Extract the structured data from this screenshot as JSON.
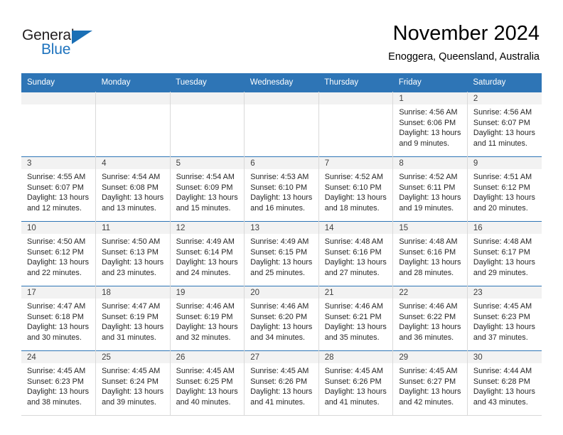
{
  "brand": {
    "name_part1": "General",
    "name_part2": "Blue",
    "logo_icon": "triangle-flag-icon",
    "accent_color": "#1a6fb5"
  },
  "header": {
    "title": "November 2024",
    "subtitle": "Enoggera, Queensland, Australia"
  },
  "calendar": {
    "header_bg": "#2e75b6",
    "daynum_bg": "#f2f2f2",
    "weekday_headers": [
      "Sunday",
      "Monday",
      "Tuesday",
      "Wednesday",
      "Thursday",
      "Friday",
      "Saturday"
    ],
    "weeks": [
      [
        {
          "day": "",
          "empty": true,
          "sunrise": "",
          "sunset": "",
          "daylight_line1": "",
          "daylight_line2": ""
        },
        {
          "day": "",
          "empty": true,
          "sunrise": "",
          "sunset": "",
          "daylight_line1": "",
          "daylight_line2": ""
        },
        {
          "day": "",
          "empty": true,
          "sunrise": "",
          "sunset": "",
          "daylight_line1": "",
          "daylight_line2": ""
        },
        {
          "day": "",
          "empty": true,
          "sunrise": "",
          "sunset": "",
          "daylight_line1": "",
          "daylight_line2": ""
        },
        {
          "day": "",
          "empty": true,
          "sunrise": "",
          "sunset": "",
          "daylight_line1": "",
          "daylight_line2": ""
        },
        {
          "day": "1",
          "empty": false,
          "sunrise": "Sunrise: 4:56 AM",
          "sunset": "Sunset: 6:06 PM",
          "daylight_line1": "Daylight: 13 hours",
          "daylight_line2": "and 9 minutes."
        },
        {
          "day": "2",
          "empty": false,
          "sunrise": "Sunrise: 4:56 AM",
          "sunset": "Sunset: 6:07 PM",
          "daylight_line1": "Daylight: 13 hours",
          "daylight_line2": "and 11 minutes."
        }
      ],
      [
        {
          "day": "3",
          "empty": false,
          "sunrise": "Sunrise: 4:55 AM",
          "sunset": "Sunset: 6:07 PM",
          "daylight_line1": "Daylight: 13 hours",
          "daylight_line2": "and 12 minutes."
        },
        {
          "day": "4",
          "empty": false,
          "sunrise": "Sunrise: 4:54 AM",
          "sunset": "Sunset: 6:08 PM",
          "daylight_line1": "Daylight: 13 hours",
          "daylight_line2": "and 13 minutes."
        },
        {
          "day": "5",
          "empty": false,
          "sunrise": "Sunrise: 4:54 AM",
          "sunset": "Sunset: 6:09 PM",
          "daylight_line1": "Daylight: 13 hours",
          "daylight_line2": "and 15 minutes."
        },
        {
          "day": "6",
          "empty": false,
          "sunrise": "Sunrise: 4:53 AM",
          "sunset": "Sunset: 6:10 PM",
          "daylight_line1": "Daylight: 13 hours",
          "daylight_line2": "and 16 minutes."
        },
        {
          "day": "7",
          "empty": false,
          "sunrise": "Sunrise: 4:52 AM",
          "sunset": "Sunset: 6:10 PM",
          "daylight_line1": "Daylight: 13 hours",
          "daylight_line2": "and 18 minutes."
        },
        {
          "day": "8",
          "empty": false,
          "sunrise": "Sunrise: 4:52 AM",
          "sunset": "Sunset: 6:11 PM",
          "daylight_line1": "Daylight: 13 hours",
          "daylight_line2": "and 19 minutes."
        },
        {
          "day": "9",
          "empty": false,
          "sunrise": "Sunrise: 4:51 AM",
          "sunset": "Sunset: 6:12 PM",
          "daylight_line1": "Daylight: 13 hours",
          "daylight_line2": "and 20 minutes."
        }
      ],
      [
        {
          "day": "10",
          "empty": false,
          "sunrise": "Sunrise: 4:50 AM",
          "sunset": "Sunset: 6:12 PM",
          "daylight_line1": "Daylight: 13 hours",
          "daylight_line2": "and 22 minutes."
        },
        {
          "day": "11",
          "empty": false,
          "sunrise": "Sunrise: 4:50 AM",
          "sunset": "Sunset: 6:13 PM",
          "daylight_line1": "Daylight: 13 hours",
          "daylight_line2": "and 23 minutes."
        },
        {
          "day": "12",
          "empty": false,
          "sunrise": "Sunrise: 4:49 AM",
          "sunset": "Sunset: 6:14 PM",
          "daylight_line1": "Daylight: 13 hours",
          "daylight_line2": "and 24 minutes."
        },
        {
          "day": "13",
          "empty": false,
          "sunrise": "Sunrise: 4:49 AM",
          "sunset": "Sunset: 6:15 PM",
          "daylight_line1": "Daylight: 13 hours",
          "daylight_line2": "and 25 minutes."
        },
        {
          "day": "14",
          "empty": false,
          "sunrise": "Sunrise: 4:48 AM",
          "sunset": "Sunset: 6:16 PM",
          "daylight_line1": "Daylight: 13 hours",
          "daylight_line2": "and 27 minutes."
        },
        {
          "day": "15",
          "empty": false,
          "sunrise": "Sunrise: 4:48 AM",
          "sunset": "Sunset: 6:16 PM",
          "daylight_line1": "Daylight: 13 hours",
          "daylight_line2": "and 28 minutes."
        },
        {
          "day": "16",
          "empty": false,
          "sunrise": "Sunrise: 4:48 AM",
          "sunset": "Sunset: 6:17 PM",
          "daylight_line1": "Daylight: 13 hours",
          "daylight_line2": "and 29 minutes."
        }
      ],
      [
        {
          "day": "17",
          "empty": false,
          "sunrise": "Sunrise: 4:47 AM",
          "sunset": "Sunset: 6:18 PM",
          "daylight_line1": "Daylight: 13 hours",
          "daylight_line2": "and 30 minutes."
        },
        {
          "day": "18",
          "empty": false,
          "sunrise": "Sunrise: 4:47 AM",
          "sunset": "Sunset: 6:19 PM",
          "daylight_line1": "Daylight: 13 hours",
          "daylight_line2": "and 31 minutes."
        },
        {
          "day": "19",
          "empty": false,
          "sunrise": "Sunrise: 4:46 AM",
          "sunset": "Sunset: 6:19 PM",
          "daylight_line1": "Daylight: 13 hours",
          "daylight_line2": "and 32 minutes."
        },
        {
          "day": "20",
          "empty": false,
          "sunrise": "Sunrise: 4:46 AM",
          "sunset": "Sunset: 6:20 PM",
          "daylight_line1": "Daylight: 13 hours",
          "daylight_line2": "and 34 minutes."
        },
        {
          "day": "21",
          "empty": false,
          "sunrise": "Sunrise: 4:46 AM",
          "sunset": "Sunset: 6:21 PM",
          "daylight_line1": "Daylight: 13 hours",
          "daylight_line2": "and 35 minutes."
        },
        {
          "day": "22",
          "empty": false,
          "sunrise": "Sunrise: 4:46 AM",
          "sunset": "Sunset: 6:22 PM",
          "daylight_line1": "Daylight: 13 hours",
          "daylight_line2": "and 36 minutes."
        },
        {
          "day": "23",
          "empty": false,
          "sunrise": "Sunrise: 4:45 AM",
          "sunset": "Sunset: 6:23 PM",
          "daylight_line1": "Daylight: 13 hours",
          "daylight_line2": "and 37 minutes."
        }
      ],
      [
        {
          "day": "24",
          "empty": false,
          "sunrise": "Sunrise: 4:45 AM",
          "sunset": "Sunset: 6:23 PM",
          "daylight_line1": "Daylight: 13 hours",
          "daylight_line2": "and 38 minutes."
        },
        {
          "day": "25",
          "empty": false,
          "sunrise": "Sunrise: 4:45 AM",
          "sunset": "Sunset: 6:24 PM",
          "daylight_line1": "Daylight: 13 hours",
          "daylight_line2": "and 39 minutes."
        },
        {
          "day": "26",
          "empty": false,
          "sunrise": "Sunrise: 4:45 AM",
          "sunset": "Sunset: 6:25 PM",
          "daylight_line1": "Daylight: 13 hours",
          "daylight_line2": "and 40 minutes."
        },
        {
          "day": "27",
          "empty": false,
          "sunrise": "Sunrise: 4:45 AM",
          "sunset": "Sunset: 6:26 PM",
          "daylight_line1": "Daylight: 13 hours",
          "daylight_line2": "and 41 minutes."
        },
        {
          "day": "28",
          "empty": false,
          "sunrise": "Sunrise: 4:45 AM",
          "sunset": "Sunset: 6:26 PM",
          "daylight_line1": "Daylight: 13 hours",
          "daylight_line2": "and 41 minutes."
        },
        {
          "day": "29",
          "empty": false,
          "sunrise": "Sunrise: 4:45 AM",
          "sunset": "Sunset: 6:27 PM",
          "daylight_line1": "Daylight: 13 hours",
          "daylight_line2": "and 42 minutes."
        },
        {
          "day": "30",
          "empty": false,
          "sunrise": "Sunrise: 4:44 AM",
          "sunset": "Sunset: 6:28 PM",
          "daylight_line1": "Daylight: 13 hours",
          "daylight_line2": "and 43 minutes."
        }
      ]
    ]
  }
}
